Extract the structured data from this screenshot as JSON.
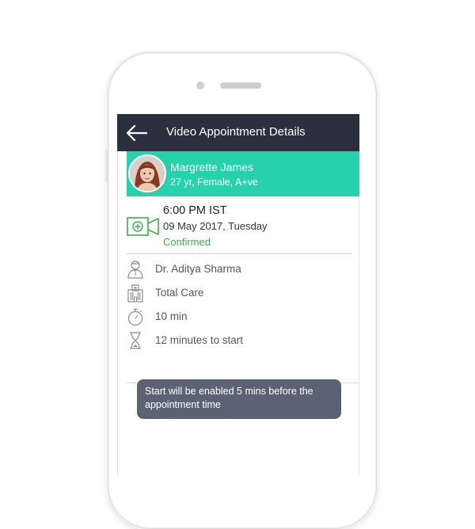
{
  "appbar": {
    "title": "Video Appointment Details",
    "back_icon": "arrow-left-icon",
    "background": "#2b303f"
  },
  "patient": {
    "name": "Margrette James",
    "meta": "27 yr, Female, A+ve",
    "banner_color": "#27d1ac"
  },
  "appointment": {
    "time": "6:00 PM IST",
    "date": "09 May 2017, Tuesday",
    "status": "Confirmed",
    "status_color": "#3fae48",
    "type_icon": "video-call-icon"
  },
  "details": [
    {
      "icon": "doctor-icon",
      "text": "Dr. Aditya Sharma"
    },
    {
      "icon": "hospital-icon",
      "text": "Total Care"
    },
    {
      "icon": "stopwatch-icon",
      "text": "10 min"
    },
    {
      "icon": "hourglass-icon",
      "text": "12 minutes to start"
    }
  ],
  "toast": {
    "message": "Start will be enabled 5 mins before the appointment time"
  }
}
